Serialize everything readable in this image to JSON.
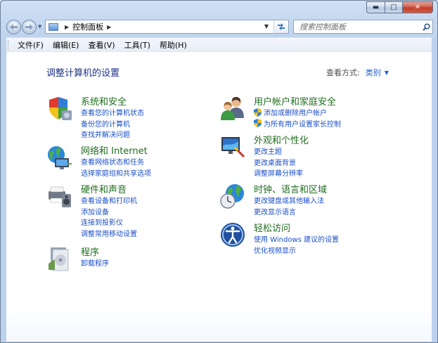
{
  "window": {
    "caption_buttons": {
      "minimize": "▬",
      "maximize": "□",
      "close": "✕"
    }
  },
  "address_bar": {
    "path": "控制面板",
    "arrow": "▶",
    "trail_arrow": "▶"
  },
  "search": {
    "placeholder": "搜索控制面板"
  },
  "menubar": {
    "items": [
      "文件(F)",
      "编辑(E)",
      "查看(V)",
      "工具(T)",
      "帮助(H)"
    ]
  },
  "main": {
    "title": "调整计算机的设置",
    "view_by_label": "查看方式:",
    "view_by_value": "类别",
    "categories": [
      {
        "title": "系统和安全",
        "links": [
          "查看您的计算机状态",
          "备份您的计算机",
          "查找并解决问题"
        ],
        "icon": "system-security-icon"
      },
      {
        "title": "网络和 Internet",
        "links": [
          "查看网络状态和任务",
          "选择家庭组和共享选项"
        ],
        "icon": "network-internet-icon"
      },
      {
        "title": "硬件和声音",
        "links": [
          "查看设备和打印机",
          "添加设备",
          "连接到投影仪",
          "调整常用移动设置"
        ],
        "icon": "hardware-sound-icon"
      },
      {
        "title": "程序",
        "links": [
          "卸载程序"
        ],
        "icon": "programs-icon"
      },
      {
        "title": "用户帐户和家庭安全",
        "links": [
          "添加或删除用户帐户",
          "为所有用户设置家长控制"
        ],
        "icon": "user-accounts-icon"
      },
      {
        "title": "外观和个性化",
        "links": [
          "更改主题",
          "更改桌面背景",
          "调整屏幕分辨率"
        ],
        "icon": "appearance-icon"
      },
      {
        "title": "时钟、语言和区域",
        "links": [
          "更改键盘或其他输入法",
          "更改显示语言"
        ],
        "icon": "clock-language-icon"
      },
      {
        "title": "轻松访问",
        "links": [
          "使用 Windows 建议的设置",
          "优化视频显示"
        ],
        "icon": "ease-of-access-icon"
      }
    ]
  },
  "colors": {
    "link": "#1a4fc9",
    "category_title": "#1f6e1f",
    "page_title": "#1e3287"
  }
}
